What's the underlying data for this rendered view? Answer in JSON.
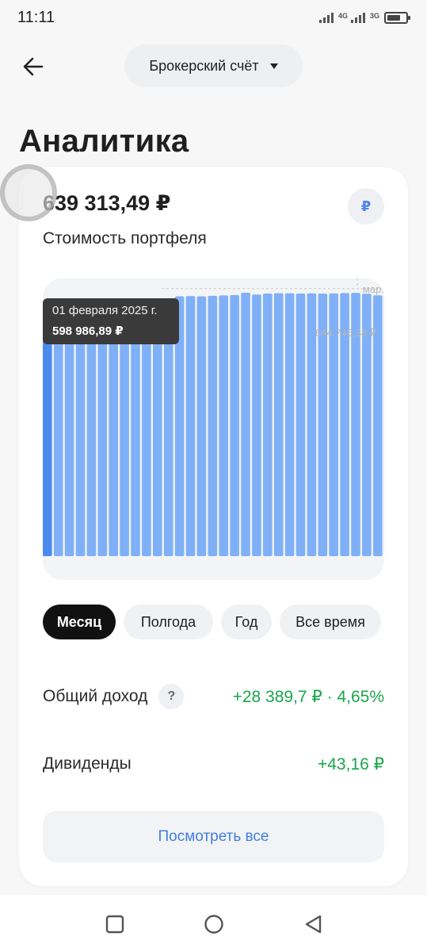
{
  "status_bar": {
    "time": "11:11",
    "network_1": "4G",
    "network_2": "3G"
  },
  "header": {
    "account_selector": "Брокерский счёт"
  },
  "page": {
    "title": "Аналитика"
  },
  "portfolio": {
    "value": "639 313,49 ₽",
    "label": "Стоимость портфеля",
    "currency_symbol": "₽"
  },
  "chart_data": {
    "type": "bar",
    "title": "",
    "xlabel": "",
    "ylabel": "",
    "period_label": "мар.",
    "max_label": "644 745,38 ₽",
    "max_value": 644745.38,
    "selected_index": 0,
    "tooltip": {
      "date": "01 февраля 2025 г.",
      "value": "598 986,89 ₽"
    },
    "ylim": [
      0,
      650000
    ],
    "values": [
      598986.89,
      598200,
      597900,
      597600,
      598400,
      598700,
      598300,
      598500,
      599100,
      599400,
      599300,
      603600,
      626200,
      626600,
      626000,
      627400,
      628300,
      629100,
      634600,
      630500,
      632900,
      633600,
      633400,
      632900,
      633300,
      632600,
      633000,
      633900,
      634400,
      632200,
      628600,
      632400,
      632200
    ],
    "colors": {
      "bar": "#7fb0f7",
      "selected_bar": "#4a8bef"
    }
  },
  "periods": [
    {
      "label": "Месяц",
      "active": true
    },
    {
      "label": "Полгода",
      "active": false
    },
    {
      "label": "Год",
      "active": false
    },
    {
      "label": "Все время",
      "active": false
    }
  ],
  "income": {
    "label": "Общий доход",
    "help_icon": "?",
    "value": "+28 389,7 ₽ · 4,65%"
  },
  "dividends": {
    "label": "Дивиденды",
    "value": "+43,16 ₽"
  },
  "actions": {
    "view_all": "Посмотреть все"
  },
  "colors": {
    "accent_blue": "#3f7fe0",
    "positive_green": "#1aa54a"
  }
}
